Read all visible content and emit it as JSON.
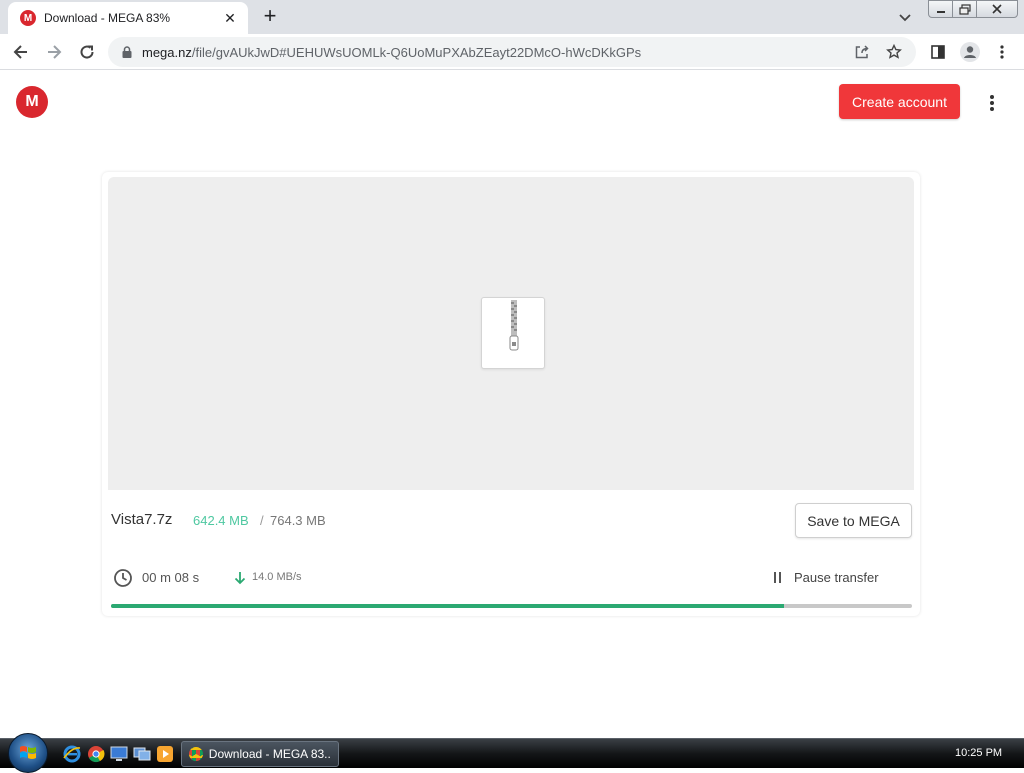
{
  "browser": {
    "tab_title": "Download - MEGA 83%",
    "tab_favicon": "mega-favicon",
    "url_host": "mega.nz",
    "url_path": "/file/gvAUkJwD#UEHUWsUOMLk-Q6UoMuPXAbZEayt22DMcO-hWcDKkGPs",
    "icons": [
      "back-arrow-icon",
      "forward-arrow-icon",
      "reload-icon",
      "lock-icon",
      "share-icon",
      "bookmark-star-icon",
      "side-panel-icon",
      "profile-icon",
      "chrome-menu-icon"
    ]
  },
  "header": {
    "logo_letter": "M",
    "create_account_label": "Create account",
    "brand_color": "#d9272e",
    "button_color": "#f0373a"
  },
  "download": {
    "file_name": "Vista7.7z",
    "downloaded": "642.4 MB",
    "separator": "/",
    "total": "764.3 MB",
    "save_label": "Save to MEGA",
    "time_remaining": "00 m  08 s",
    "speed": "14.0 MB/s",
    "pause_label": "Pause transfer",
    "progress_fraction": 0.84,
    "progress_color": "#2ba972",
    "file_type_icon": "zip-archive-icon"
  },
  "taskbar": {
    "task_label": "Download - MEGA 83...",
    "clock": "10:25 PM",
    "quick_launch": [
      "ie-icon",
      "chrome-icon",
      "show-desktop-icon",
      "switch-windows-icon",
      "media-player-icon"
    ]
  }
}
